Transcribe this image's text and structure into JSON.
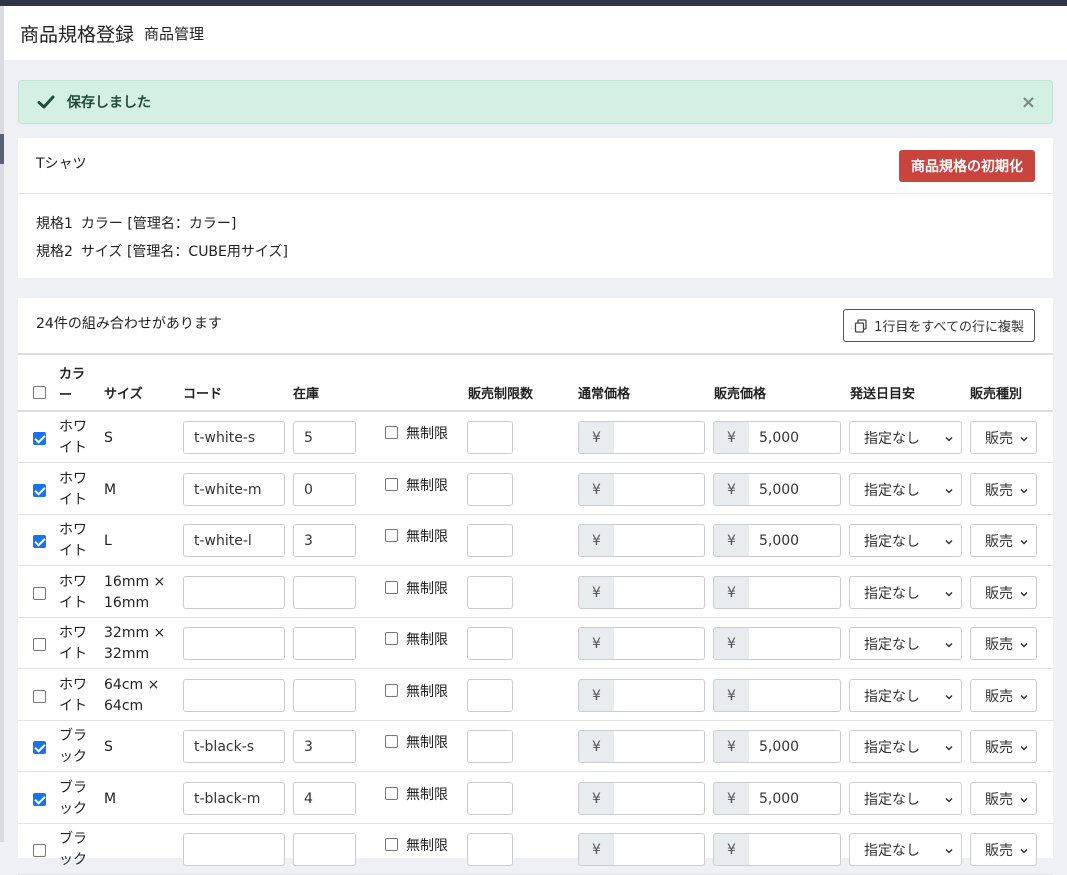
{
  "header": {
    "title": "商品規格登録",
    "subtitle": "商品管理"
  },
  "alert": {
    "message": "保存しました",
    "close": "×"
  },
  "product": {
    "name": "Tシャツ",
    "reset_label": "商品規格の初期化",
    "spec1_key": "規格1",
    "spec1_value": "カラー [管理名：カラー]",
    "spec2_key": "規格2",
    "spec2_value": "サイズ [管理名：CUBE用サイズ]"
  },
  "list": {
    "count_text": "24件の組み合わせがあります",
    "copy_label": "1行目をすべての行に複製",
    "headers": {
      "color": "カラ\nー",
      "size": "サイズ",
      "code": "コード",
      "stock": "在庫",
      "limit": "販売制限数",
      "normal_price": "通常価格",
      "sale_price": "販売価格",
      "ship": "発送日目安",
      "type": "販売種別"
    },
    "unlimited_label": "無制限",
    "yen": "¥",
    "ship_option": "指定なし",
    "type_option": "販売",
    "rows": [
      {
        "checked": true,
        "color": "ホワ\nイト",
        "size": "S",
        "code": "t-white-s",
        "stock": "5",
        "normal": "",
        "sale": "5,000"
      },
      {
        "checked": true,
        "color": "ホワ\nイト",
        "size": "M",
        "code": "t-white-m",
        "stock": "0",
        "normal": "",
        "sale": "5,000"
      },
      {
        "checked": true,
        "color": "ホワ\nイト",
        "size": "L",
        "code": "t-white-l",
        "stock": "3",
        "normal": "",
        "sale": "5,000"
      },
      {
        "checked": false,
        "color": "ホワ\nイト",
        "size": "16mm ×\n16mm",
        "code": "",
        "stock": "",
        "normal": "",
        "sale": ""
      },
      {
        "checked": false,
        "color": "ホワ\nイト",
        "size": "32mm ×\n32mm",
        "code": "",
        "stock": "",
        "normal": "",
        "sale": ""
      },
      {
        "checked": false,
        "color": "ホワ\nイト",
        "size": "64cm ×\n64cm",
        "code": "",
        "stock": "",
        "normal": "",
        "sale": ""
      },
      {
        "checked": true,
        "color": "ブラ\nック",
        "size": "S",
        "code": "t-black-s",
        "stock": "3",
        "normal": "",
        "sale": "5,000"
      },
      {
        "checked": true,
        "color": "ブラ\nック",
        "size": "M",
        "code": "t-black-m",
        "stock": "4",
        "normal": "",
        "sale": "5,000"
      },
      {
        "checked": false,
        "color": "ブラ\nック",
        "size": "",
        "code": "",
        "stock": "",
        "normal": "",
        "sale": ""
      }
    ]
  },
  "colors": {
    "danger": "#c9443f",
    "success_bg": "#d4efe3",
    "checkbox_on": "#1a73e8"
  }
}
